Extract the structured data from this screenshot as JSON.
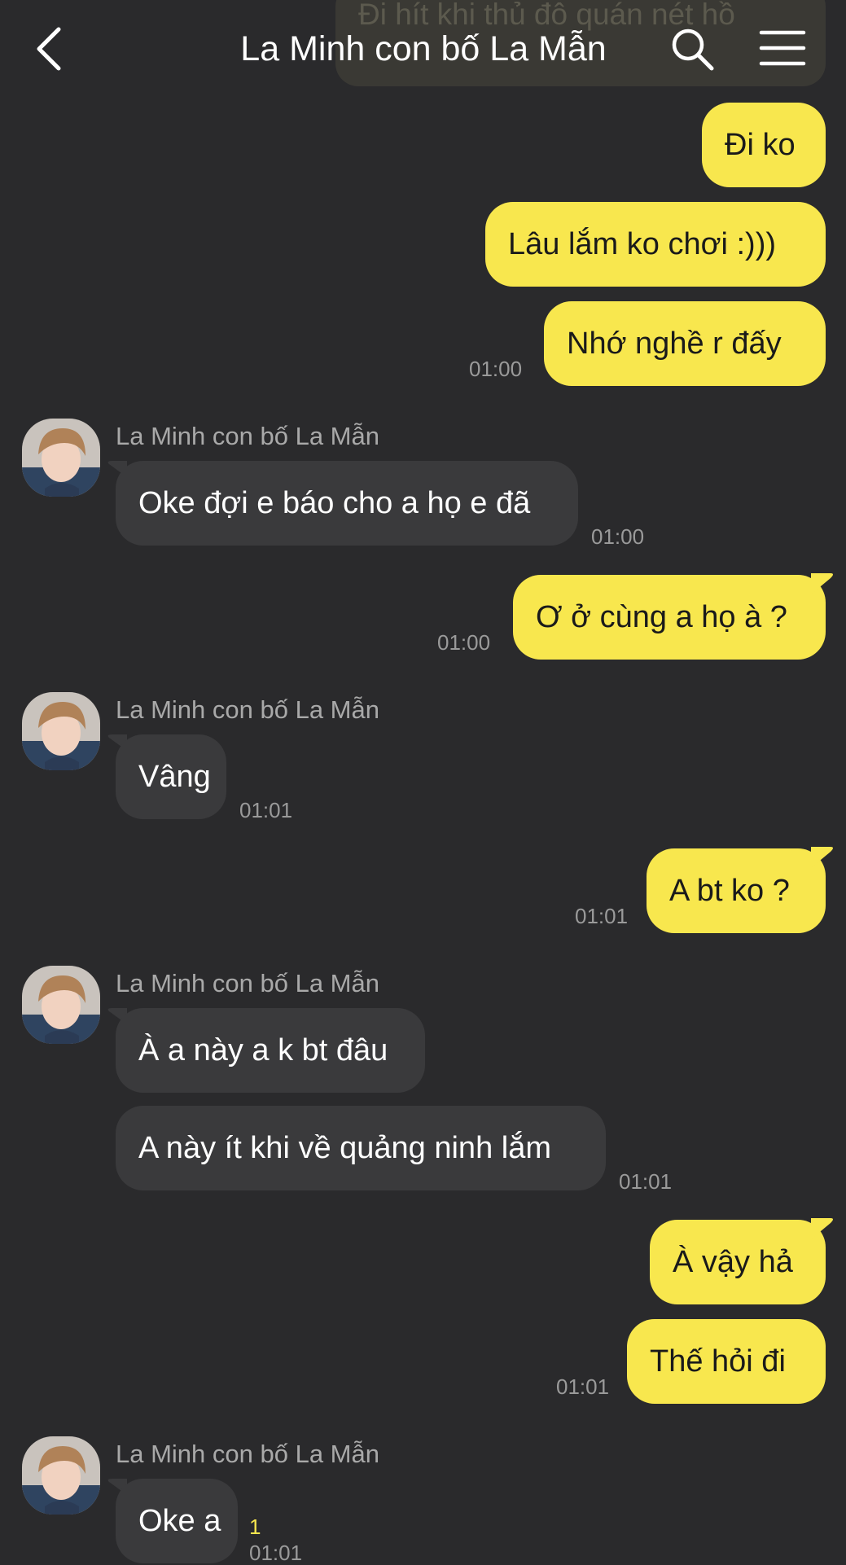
{
  "header": {
    "title": "La Minh con bố La Mẫn",
    "back_icon": "chevron-left-icon",
    "search_icon": "search-icon",
    "menu_icon": "menu-icon"
  },
  "top_partial_message": "Đi hít khi thủ đô quán nét hồ",
  "messages": [
    {
      "text": "Đi ko"
    },
    {
      "text": "Lâu lắm ko chơi :)))"
    },
    {
      "text": "Nhớ nghề r đấy",
      "time": "01:00"
    },
    {
      "sender": "La Minh con bố La Mẫn",
      "text": "Oke đợi e báo cho a họ e đã",
      "time": "01:00"
    },
    {
      "text": "Ơ ở cùng a họ à ?",
      "time": "01:00"
    },
    {
      "sender": "La Minh con bố La Mẫn",
      "text": "Vâng",
      "time": "01:01"
    },
    {
      "text": "A bt ko ?",
      "time": "01:01"
    },
    {
      "sender": "La Minh con bố La Mẫn",
      "text": "À a này a k bt đâu"
    },
    {
      "text": "A này ít khi về quảng ninh lắm",
      "time": "01:01"
    },
    {
      "text": "À vậy hả"
    },
    {
      "text": "Thế hỏi đi",
      "time": "01:01"
    },
    {
      "sender": "La Minh con bố La Mẫn",
      "text": "Oke a",
      "time": "01:01",
      "unread": "1"
    }
  ],
  "colors": {
    "background": "#2a2a2c",
    "my_bubble": "#f8e74e",
    "their_bubble": "#3a3a3c"
  }
}
